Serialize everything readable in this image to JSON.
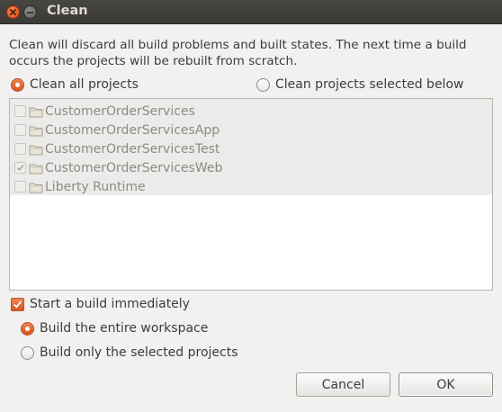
{
  "window": {
    "title": "Clean",
    "close_icon": "close-icon",
    "minimize_icon": "minimize-icon"
  },
  "description": "Clean will discard all build problems and built states.  The next time a build occurs the projects will be rebuilt from scratch.",
  "clean_scope": {
    "all_label": "Clean all projects",
    "selected_label": "Clean projects selected below",
    "selected": "all"
  },
  "projects": [
    {
      "name": "CustomerOrderServices",
      "checked": false
    },
    {
      "name": "CustomerOrderServicesApp",
      "checked": false
    },
    {
      "name": "CustomerOrderServicesTest",
      "checked": false
    },
    {
      "name": "CustomerOrderServicesWeb",
      "checked": true
    },
    {
      "name": "Liberty Runtime",
      "checked": false
    }
  ],
  "build": {
    "start_label": "Start a build immediately",
    "start_checked": true,
    "entire_label": "Build the entire workspace",
    "selected_label": "Build only the selected projects",
    "selected": "entire"
  },
  "buttons": {
    "cancel": "Cancel",
    "ok": "OK"
  },
  "colors": {
    "accent": "#e15a1f",
    "titlebar": "#3c3b37"
  }
}
